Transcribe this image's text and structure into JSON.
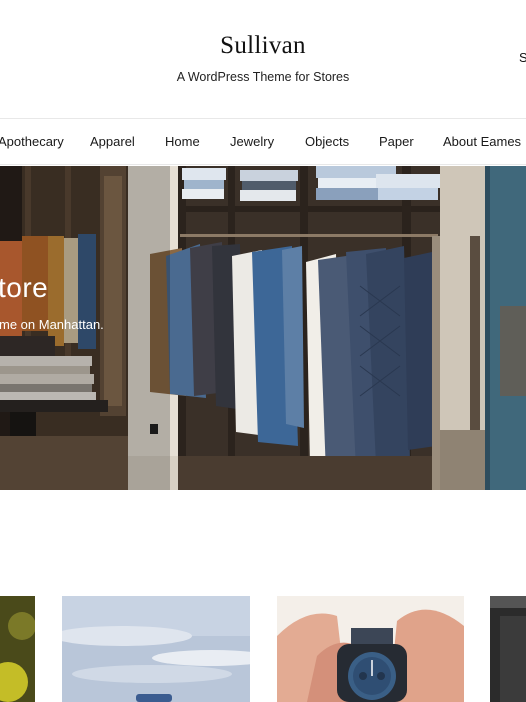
{
  "header": {
    "title": "Sullivan",
    "tagline": "A WordPress Theme for Stores",
    "cut_off_text": "S"
  },
  "nav": {
    "items": [
      {
        "label": "Apothecary"
      },
      {
        "label": "Apparel"
      },
      {
        "label": "Home"
      },
      {
        "label": "Jewelry"
      },
      {
        "label": "Objects"
      },
      {
        "label": "Paper"
      },
      {
        "label": "About Eames",
        "has_dropdown": true
      }
    ]
  },
  "hero": {
    "title": "tore",
    "subtitle": "me on Manhattan."
  },
  "products": [
    {
      "name": "product-image-yellow"
    },
    {
      "name": "product-image-sky"
    },
    {
      "name": "product-image-watch"
    },
    {
      "name": "product-image-dark"
    }
  ],
  "colors": {
    "nav_border": "#e8e8e8",
    "text": "#1a1a1a",
    "hero_text": "#ffffff"
  }
}
